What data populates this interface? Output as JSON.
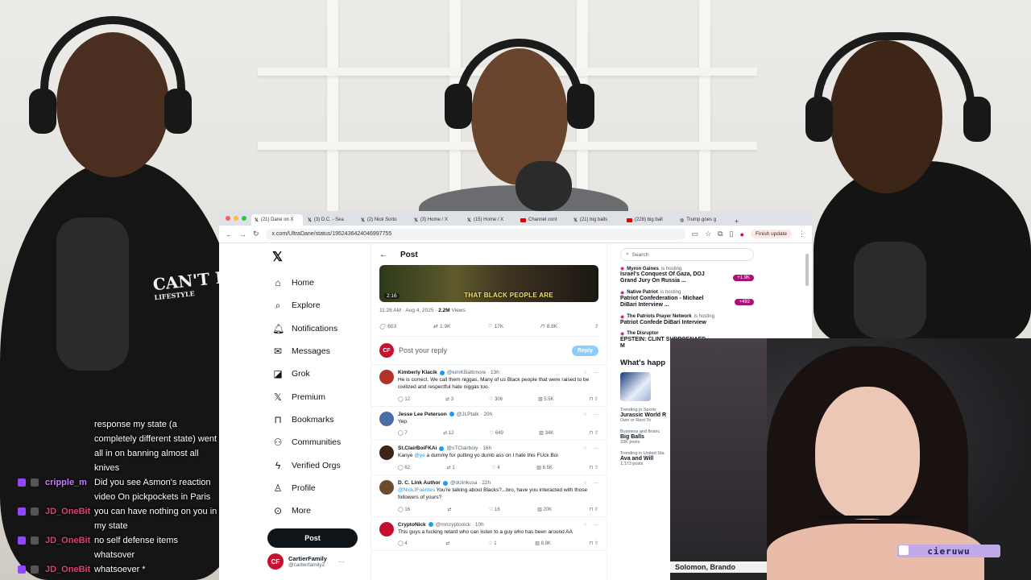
{
  "browser": {
    "tabs": [
      {
        "label": "(21) Dane on X",
        "icon": "x-icon",
        "active": true
      },
      {
        "label": "(3) D.C. - Sea",
        "icon": "x-icon"
      },
      {
        "label": "(2) Nick Sorto",
        "icon": "x-icon"
      },
      {
        "label": "(3) Home / X",
        "icon": "x-icon"
      },
      {
        "label": "(15) Home / X",
        "icon": "x-icon"
      },
      {
        "label": "Channel cont",
        "icon": "youtube-icon"
      },
      {
        "label": "(21) big balls",
        "icon": "x-icon"
      },
      {
        "label": "(228) big ball",
        "icon": "youtube-icon"
      },
      {
        "label": "Trump goes g",
        "icon": "globe-icon"
      }
    ],
    "url": "x.com/UltraDane/status/1952436424046997755",
    "finish_update": "Finish update"
  },
  "x": {
    "logo": "𝕏",
    "nav": [
      {
        "label": "Home",
        "icon": "home-icon",
        "glyph": "⌂"
      },
      {
        "label": "Explore",
        "icon": "search-icon",
        "glyph": "⌕"
      },
      {
        "label": "Notifications",
        "icon": "bell-icon",
        "glyph": "🔔︎",
        "badge": "20+"
      },
      {
        "label": "Messages",
        "icon": "mail-icon",
        "glyph": "✉"
      },
      {
        "label": "Grok",
        "icon": "grok-icon",
        "glyph": "◪"
      },
      {
        "label": "Premium",
        "icon": "x-premium-icon",
        "glyph": "𝕏"
      },
      {
        "label": "Bookmarks",
        "icon": "bookmark-icon",
        "glyph": "⊓"
      },
      {
        "label": "Communities",
        "icon": "people-icon",
        "glyph": "⚇"
      },
      {
        "label": "Verified Orgs",
        "icon": "lightning-icon",
        "glyph": "ϟ"
      },
      {
        "label": "Profile",
        "icon": "person-icon",
        "glyph": "♙"
      },
      {
        "label": "More",
        "icon": "more-circle-icon",
        "glyph": "⊙"
      }
    ],
    "post_button": "Post",
    "account": {
      "name": "CartierFamily",
      "handle": "@cartierfamilyZ",
      "avatar": "CF"
    },
    "post_header": "Post",
    "video": {
      "caption": "THAT BLACK PEOPLE ARE",
      "time": "2:16"
    },
    "meta": {
      "time": "11:28 AM · Aug 4, 2025 · ",
      "views": "2.2M",
      "views_label": " Views"
    },
    "actions": {
      "replies": "603",
      "reposts": "1.9K",
      "likes": "17K",
      "bookmarks": "8.8K"
    },
    "reply_prompt": "Post your reply",
    "reply_button": "Reply",
    "tweets": [
      {
        "name": "Kimberly Klacik",
        "handle": "@kimKBaltimore · 13h",
        "text": "He is correct. We call them niggas. Many of us Black people that were raised to be civilized and respectful hate niggas too.",
        "replies": "12",
        "reposts": "3",
        "likes": "306",
        "views": "5.5K",
        "avatar_color": "#b0322d"
      },
      {
        "name": "Jesse Lee Peterson",
        "handle": "@JLPtalk · 20h",
        "text": "Yep.",
        "replies": "7",
        "reposts": "12",
        "likes": "649",
        "views": "34K",
        "avatar_color": "#4a6fa5"
      },
      {
        "name": "St.ClairBoiFKAi",
        "handle": "@sTClairboiy · 16h",
        "mention": "@ye",
        "text_pre": "Kanye ",
        "text": " a dummy for putting yo dumb ass on I hate this FUck Boi",
        "replies": "62",
        "reposts": "1",
        "likes": "4",
        "views": "6.5K",
        "avatar_color": "#3b2418"
      },
      {
        "name": "D. C. Link Author",
        "handle": "@dclinkusa · 22h",
        "mention": "@NickJFuentes",
        "text_pre": "",
        "text": " You're talking about Blacks?...bro, have you interacted with those followers of yours?",
        "replies": "16",
        "reposts": "",
        "likes": "16",
        "views": "20K",
        "avatar_color": "#6b4a2e"
      },
      {
        "name": "CryptoNick",
        "handle": "@mrcryptonick · 10h",
        "text": "This guys a fucking retard who can listen to a guy who has been around AA",
        "replies": "4",
        "reposts": "",
        "likes": "1",
        "views": "8.8K",
        "avatar_color": "#c8102e"
      }
    ],
    "search_placeholder": "Search",
    "spaces": [
      {
        "host": "Myron Gaines",
        "suffix": "is hosting",
        "title": "Israel's Conquest Of Gaza, DOJ Grand Jury On Russia ...",
        "listeners": "+1.9K"
      },
      {
        "host": "Native Patriot",
        "suffix": "is hosting",
        "title": "Patriot Confederation - Michael DiBari Interview ...",
        "listeners": "+492"
      },
      {
        "host": "The Patriots Prayer Network",
        "suffix": "is hosting",
        "title": "Patriot Confede DiBari Interview",
        "listeners": ""
      },
      {
        "host": "The Disruptor",
        "suffix": "",
        "title": "EPSTEIN: CLINT SUBPOENAED M",
        "listeners": ""
      }
    ],
    "whats_happening": "What's happ",
    "trends": [
      {
        "category": "Trending in Sports",
        "name": "Jurassic World R",
        "sub": "Own or Rent To"
      },
      {
        "category": "Business and financ",
        "name": "Big Balls",
        "sub": "33K posts"
      },
      {
        "category": "Trending in United Sta",
        "name": "Ava and Will",
        "sub": "1,173 posts"
      }
    ]
  },
  "chat": [
    {
      "user": "",
      "msg": "response my state (a"
    },
    {
      "user": "",
      "msg": "completely different state) went"
    },
    {
      "user": "",
      "msg": "all in on banning almost all"
    },
    {
      "user": "",
      "msg": "knives"
    },
    {
      "user": "cripple_m",
      "msg": "Did you see Asmon's reaction"
    },
    {
      "user": "",
      "msg": "video On pickpockets in Paris"
    },
    {
      "user": "JD_OneBit",
      "msg": "you can have nothing on you in"
    },
    {
      "user": "",
      "msg": "my state"
    },
    {
      "user": "JD_OneBit",
      "msg": "no self defense items"
    },
    {
      "user": "",
      "msg": "whatsover"
    },
    {
      "user": "JD_OneBit",
      "msg": "whatsoever *"
    }
  ],
  "stream": {
    "shirt_text": "CAN'T FOLD",
    "shirt_sub": "LIFESTYLE",
    "streamer_tag": "cieruwu",
    "caption": "Solomon, Brando"
  },
  "colors": {
    "x_blue": "#1d9bf0",
    "spaces_purple": "#a91079",
    "twitch_purple": "#9146ff"
  }
}
